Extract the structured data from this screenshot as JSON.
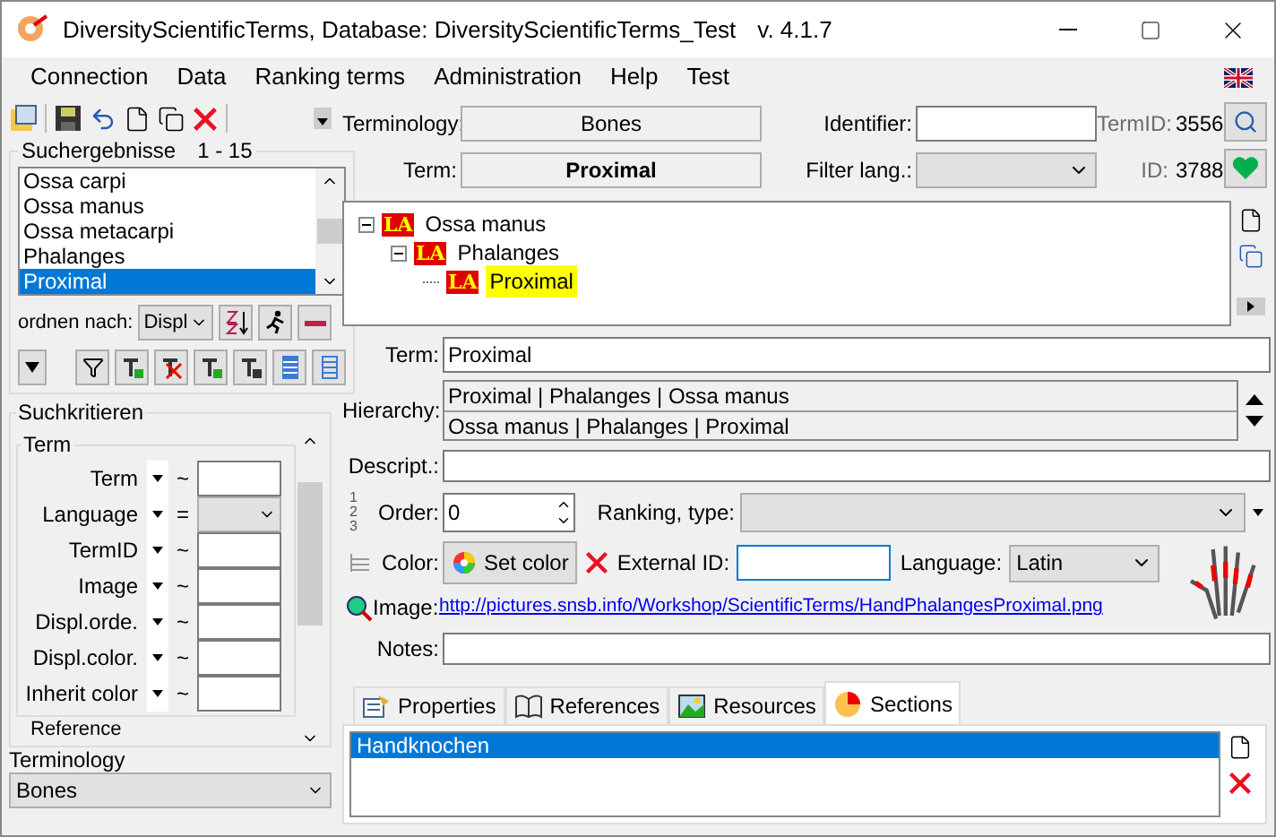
{
  "window": {
    "title": "DiversityScientificTerms,  Database: DiversityScientificTerms_Test",
    "version": "v. 4.1.7"
  },
  "menu": [
    "Connection",
    "Data",
    "Ranking terms",
    "Administration",
    "Help",
    "Test"
  ],
  "search_results": {
    "title": "Suchergebnisse",
    "range": "1 - 15",
    "sort_label": "ordnen nach:",
    "sort_value": "Displ",
    "items": [
      {
        "label": "Ossa carpi",
        "selected": false
      },
      {
        "label": "Ossa manus",
        "selected": false
      },
      {
        "label": "Ossa metacarpi",
        "selected": false
      },
      {
        "label": "Phalanges",
        "selected": false
      },
      {
        "label": "Proximal",
        "selected": true
      }
    ]
  },
  "search_criteria": {
    "title": "Suchkritieren",
    "group": "Term",
    "next_group": "Reference",
    "rows": [
      {
        "label": "Term",
        "operator": "~",
        "kind": "text"
      },
      {
        "label": "Language",
        "operator": "=",
        "kind": "select"
      },
      {
        "label": "TermID",
        "operator": "~",
        "kind": "text"
      },
      {
        "label": "Image",
        "operator": "~",
        "kind": "text"
      },
      {
        "label": "Displ.orde.",
        "operator": "~",
        "kind": "text"
      },
      {
        "label": "Displ.color.",
        "operator": "~",
        "kind": "text"
      },
      {
        "label": "Inherit color",
        "operator": "~",
        "kind": "text"
      }
    ]
  },
  "terminology": {
    "label": "Terminology",
    "value": "Bones"
  },
  "header": {
    "terminology_label": "Terminology:",
    "terminology": "Bones",
    "term_label": "Term:",
    "term": "Proximal",
    "identifier_label": "Identifier:",
    "filter_label": "Filter lang.:",
    "termid_label": "TermID:",
    "termid": "3556",
    "id_label": "ID:",
    "id": "3788"
  },
  "tree": [
    {
      "badge": "LA",
      "label": "Ossa manus",
      "selected": false,
      "children": [
        {
          "badge": "LA",
          "label": "Phalanges",
          "selected": false,
          "children": [
            {
              "badge": "LA",
              "label": "Proximal",
              "selected": true
            }
          ]
        }
      ]
    }
  ],
  "form": {
    "term_label": "Term:",
    "term": "Proximal",
    "hierarchy_label": "Hierarchy:",
    "hierarchy": [
      "Proximal | Phalanges | Ossa manus",
      "Ossa manus | Phalanges | Proximal"
    ],
    "description_label": "Descript.:",
    "order_numbers": [
      "1",
      "2",
      "3"
    ],
    "order_label": "Order:",
    "order": "0",
    "ranking_label": "Ranking, type:",
    "color_label": "Color:",
    "color_button": "Set color",
    "external_id_label": "External ID:",
    "language_label": "Language:",
    "language": "Latin",
    "image_label": "Image:",
    "image_url": "http://pictures.snsb.info/Workshop/ScientificTerms/HandPhalangesProximal.png",
    "notes_label": "Notes:"
  },
  "tabs": [
    {
      "label": "Properties",
      "selected": false
    },
    {
      "label": "References",
      "selected": false
    },
    {
      "label": "Resources",
      "selected": false
    },
    {
      "label": "Sections",
      "selected": true
    }
  ],
  "sections": [
    {
      "label": "Handknochen",
      "selected": true
    }
  ]
}
